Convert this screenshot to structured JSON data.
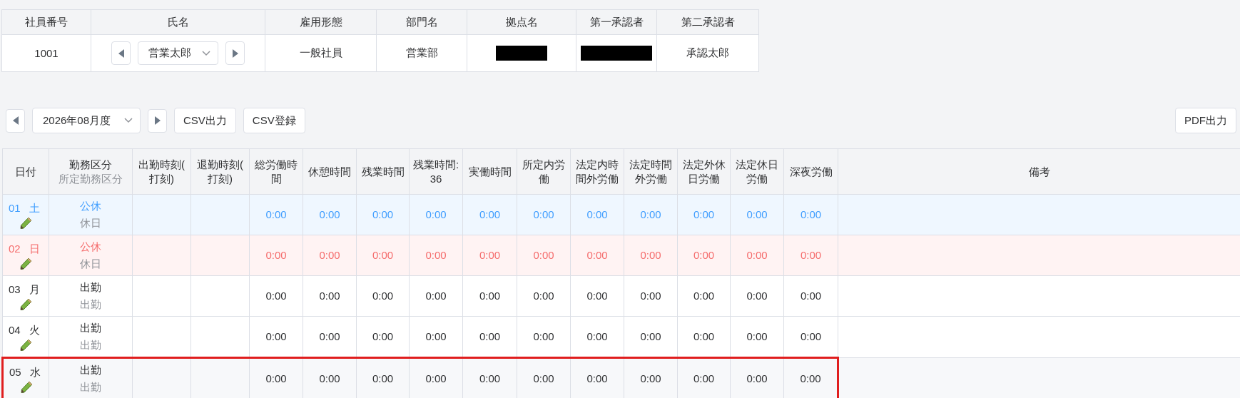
{
  "employee": {
    "columns": [
      "社員番号",
      "氏名",
      "雇用形態",
      "部門名",
      "拠点名",
      "第一承認者",
      "第二承認者"
    ],
    "cells": [
      {
        "text": "1001"
      },
      {
        "kind": "selector",
        "text": "営業太郎"
      },
      {
        "text": "一般社員"
      },
      {
        "text": "営業部"
      },
      {
        "redacted": true
      },
      {
        "redacted": true
      },
      {
        "text": "承認太郎"
      }
    ]
  },
  "toolbar": {
    "month": "2026年08月度",
    "buttons": [
      "CSV出力",
      "CSV登録"
    ],
    "pdf_button": "PDF出力"
  },
  "table": {
    "columns": [
      {
        "label": "日付"
      },
      {
        "label": "勤務区分",
        "sub": "所定勤務区分"
      },
      {
        "label": "出勤時刻(打刻)"
      },
      {
        "label": "退勤時刻(打刻)"
      },
      {
        "label": "総労働時間"
      },
      {
        "label": "休憩時間"
      },
      {
        "label": "残業時間"
      },
      {
        "label": "残業時間:36"
      },
      {
        "label": "実働時間"
      },
      {
        "label": "所定内労働"
      },
      {
        "label": "法定内時間外労働"
      },
      {
        "label": "法定時間外労働"
      },
      {
        "label": "法定外休日労働"
      },
      {
        "label": "法定休日労働"
      },
      {
        "label": "深夜労働"
      },
      {
        "label": "備考"
      }
    ],
    "rows": [
      {
        "kind": "saturday",
        "day": "01",
        "weekday": "土",
        "work_type": "公休",
        "scheduled_type": "休日",
        "times": [
          "0:00",
          "0:00",
          "0:00",
          "0:00",
          "0:00",
          "0:00",
          "0:00",
          "0:00",
          "0:00",
          "0:00",
          "0:00"
        ],
        "highlighted": false
      },
      {
        "kind": "sunday",
        "day": "02",
        "weekday": "日",
        "work_type": "公休",
        "scheduled_type": "休日",
        "times": [
          "0:00",
          "0:00",
          "0:00",
          "0:00",
          "0:00",
          "0:00",
          "0:00",
          "0:00",
          "0:00",
          "0:00",
          "0:00"
        ],
        "highlighted": false
      },
      {
        "kind": "weekday",
        "day": "03",
        "weekday": "月",
        "work_type": "出勤",
        "scheduled_type": "出勤",
        "times": [
          "0:00",
          "0:00",
          "0:00",
          "0:00",
          "0:00",
          "0:00",
          "0:00",
          "0:00",
          "0:00",
          "0:00",
          "0:00"
        ],
        "highlighted": false
      },
      {
        "kind": "weekday",
        "day": "04",
        "weekday": "火",
        "work_type": "出勤",
        "scheduled_type": "出勤",
        "times": [
          "0:00",
          "0:00",
          "0:00",
          "0:00",
          "0:00",
          "0:00",
          "0:00",
          "0:00",
          "0:00",
          "0:00",
          "0:00"
        ],
        "highlighted": false
      },
      {
        "kind": "weekday",
        "day": "05",
        "weekday": "水",
        "work_type": "出勤",
        "scheduled_type": "出勤",
        "times": [
          "0:00",
          "0:00",
          "0:00",
          "0:00",
          "0:00",
          "0:00",
          "0:00",
          "0:00",
          "0:00",
          "0:00",
          "0:00"
        ],
        "highlighted": true
      }
    ]
  }
}
